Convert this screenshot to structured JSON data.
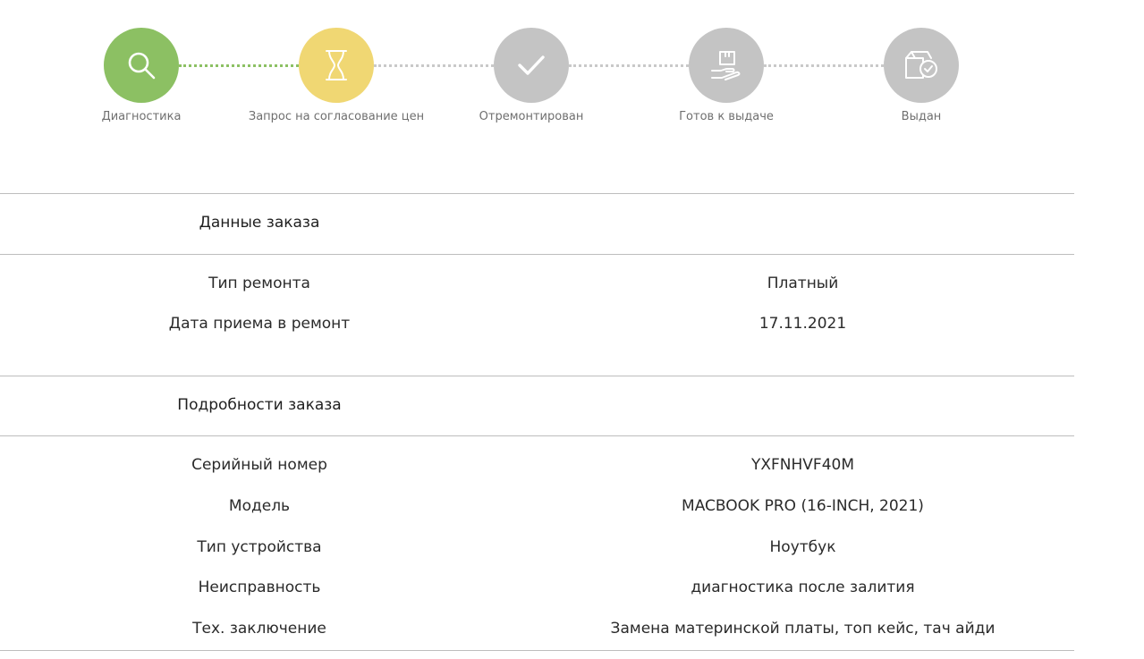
{
  "tracker": {
    "steps": [
      {
        "label": "Диагностика",
        "icon": "search-icon",
        "state": "done",
        "color": "#8cc063"
      },
      {
        "label": "Запрос на согласование цен",
        "icon": "hourglass-icon",
        "state": "current",
        "color": "#f0d773"
      },
      {
        "label": "Отремонтирован",
        "icon": "check-icon",
        "state": "pending",
        "color": "#c4c4c4"
      },
      {
        "label": "Готов к выдаче",
        "icon": "hand-box-icon",
        "state": "pending",
        "color": "#c4c4c4"
      },
      {
        "label": "Выдан",
        "icon": "box-check-icon",
        "state": "pending",
        "color": "#c4c4c4"
      }
    ]
  },
  "order_data": {
    "title": "Данные заказа",
    "rows": [
      {
        "label": "Тип ремонта",
        "value": "Платный"
      },
      {
        "label": "Дата приема в ремонт",
        "value": "17.11.2021"
      }
    ]
  },
  "order_details": {
    "title": "Подробности заказа",
    "rows": [
      {
        "label": "Серийный номер",
        "value": "YXFNHVF40M"
      },
      {
        "label": "Модель",
        "value": "MACBOOK PRO (16-INCH, 2021)"
      },
      {
        "label": "Тип устройства",
        "value": "Ноутбук"
      },
      {
        "label": "Неисправность",
        "value": "диагностика после залития"
      },
      {
        "label": "Тех. заключение",
        "value": "Замена материнской платы, топ кейс, тач айди"
      }
    ]
  }
}
